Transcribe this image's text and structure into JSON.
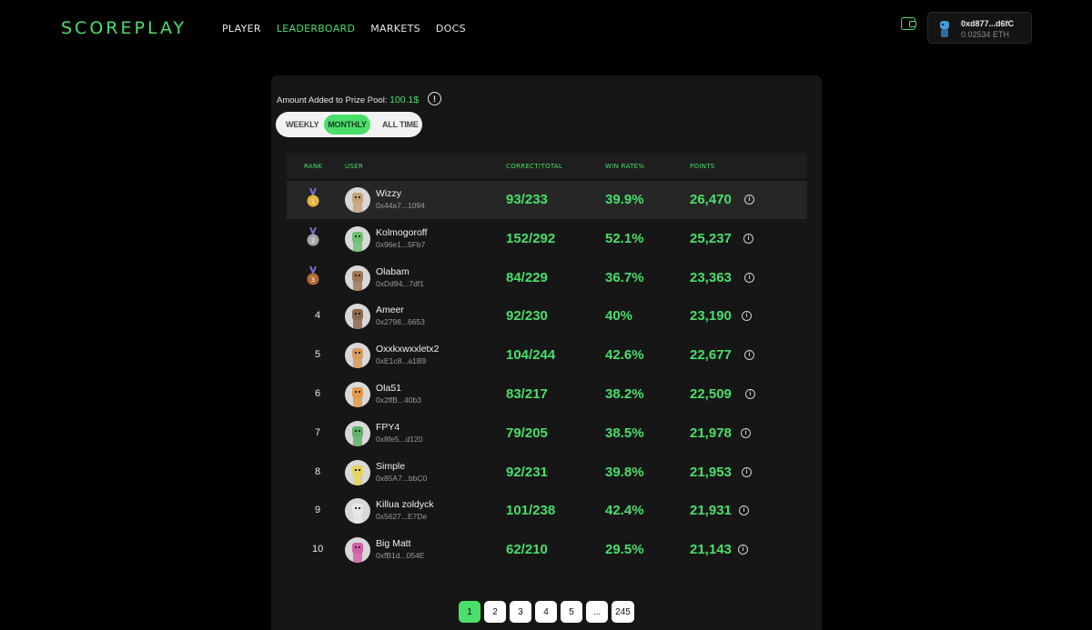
{
  "brand": "SCOREPLAY",
  "nav": [
    "PLAYER",
    "LEADERBOARD",
    "MARKETS",
    "DOCS"
  ],
  "nav_active": 1,
  "account": {
    "address": "0xd877...d6fC",
    "balance": "0.02534 ETH"
  },
  "prize_pool": {
    "label": "Amount Added to Prize Pool:",
    "amount": "100.1$"
  },
  "tabs": [
    "WEEKLY",
    "MONTHLY",
    "ALL TIME"
  ],
  "tab_active": "MONTHLY",
  "columns": {
    "rank": "RANK",
    "user": "USER",
    "correct": "CORRECT/TOTAL",
    "winrate": "WIN RATE%",
    "points": "POINTS"
  },
  "rows": [
    {
      "rank": "1",
      "name": "Wizzy",
      "addr": "0x44a7...1094",
      "correct": "93/233",
      "winrate": "39.9%",
      "points": "26,470",
      "avatar": "#c9a27a"
    },
    {
      "rank": "2",
      "name": "Kolmogoroff",
      "addr": "0x96e1...5Fb7",
      "correct": "152/292",
      "winrate": "52.1%",
      "points": "25,237",
      "avatar": "#6fbf73"
    },
    {
      "rank": "3",
      "name": "Olabam",
      "addr": "0xDd94...7df1",
      "correct": "84/229",
      "winrate": "36.7%",
      "points": "23,363",
      "avatar": "#a07a58"
    },
    {
      "rank": "4",
      "name": "Ameer",
      "addr": "0x2798...6653",
      "correct": "92/230",
      "winrate": "40%",
      "points": "23,190",
      "avatar": "#8e6a4e"
    },
    {
      "rank": "5",
      "name": "Oxxkxwxxletx2",
      "addr": "0xE1c8...a1B9",
      "correct": "104/244",
      "winrate": "42.6%",
      "points": "22,677",
      "avatar": "#d99a5b"
    },
    {
      "rank": "6",
      "name": "Ola51",
      "addr": "0x2ffB...40b3",
      "correct": "83/217",
      "winrate": "38.2%",
      "points": "22,509",
      "avatar": "#e39a4a"
    },
    {
      "rank": "7",
      "name": "FPY4",
      "addr": "0x8fe5...d120",
      "correct": "79/205",
      "winrate": "38.5%",
      "points": "21,978",
      "avatar": "#5fb16a"
    },
    {
      "rank": "8",
      "name": "Simple",
      "addr": "0x85A7...bbC0",
      "correct": "92/231",
      "winrate": "39.8%",
      "points": "21,953",
      "avatar": "#e6d35a"
    },
    {
      "rank": "9",
      "name": "Killua zoldyck",
      "addr": "0x5627...E7De",
      "correct": "101/238",
      "winrate": "42.4%",
      "points": "21,931",
      "avatar": "#e8e8e8"
    },
    {
      "rank": "10",
      "name": "Big Matt",
      "addr": "0xfB1d...054E",
      "correct": "62/210",
      "winrate": "29.5%",
      "points": "21,143",
      "avatar": "#d460a8"
    }
  ],
  "pagination": [
    "1",
    "2",
    "3",
    "4",
    "5",
    "...",
    "245"
  ],
  "page_active": "1",
  "colors": {
    "accent": "#4ade6a",
    "gold": "#e7b53b",
    "silver": "#a7a7a7",
    "bronze": "#b86a35"
  }
}
